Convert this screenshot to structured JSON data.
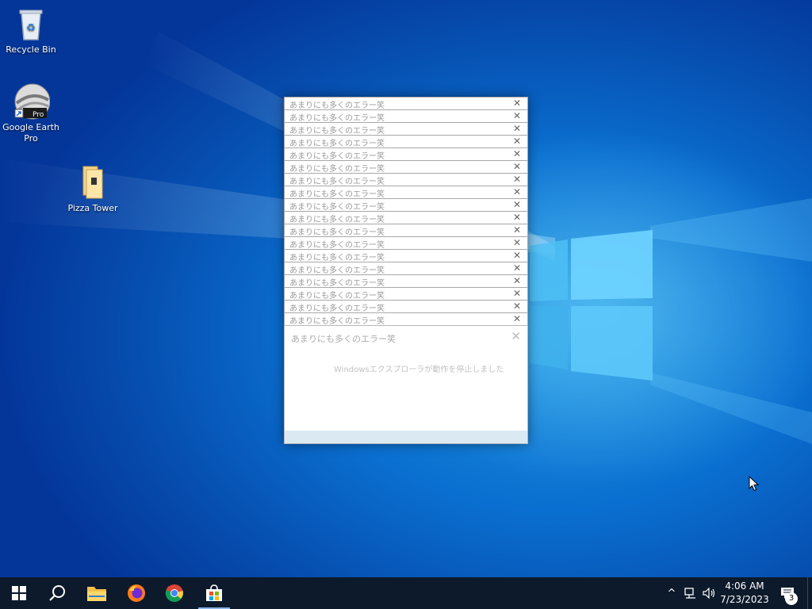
{
  "desktop": {
    "icons": [
      {
        "label": "Recycle Bin",
        "icon": "recycle-bin-icon"
      },
      {
        "label": "Google Earth Pro",
        "icon": "google-earth-pro-icon",
        "overlay": "Pro"
      },
      {
        "label": "Pizza Tower",
        "icon": "folder-icon"
      }
    ]
  },
  "error_dialogs": {
    "stack_title": "あまりにも多くのエラー笑",
    "stack_count": 18,
    "front": {
      "title": "あまりにも多くのエラー笑",
      "message": "Windowsエクスプローラが動作を停止しました"
    }
  },
  "taskbar": {
    "buttons": [
      "start-icon",
      "search-icon",
      "file-explorer-icon",
      "firefox-icon",
      "chrome-icon",
      "microsoft-store-icon"
    ],
    "active": "microsoft-store-icon",
    "tray": {
      "time": "4:06 AM",
      "date": "7/23/2023",
      "notification_count": "3"
    }
  },
  "colors": {
    "taskbar": "#0d1a2b",
    "wallpaper_blue": "#0a6fd0",
    "dialog_footer": "#dbe9f3"
  }
}
